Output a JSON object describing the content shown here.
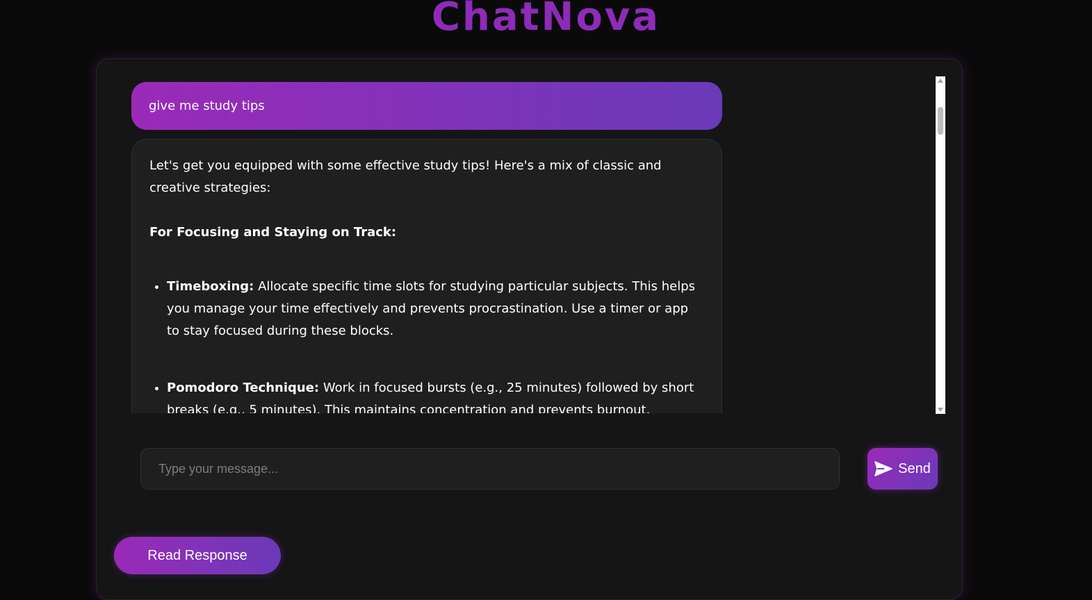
{
  "app": {
    "title": "ChatNova"
  },
  "chat": {
    "user_message": "give me study tips",
    "bot_intro": "Let's get you equipped with some effective study tips!  Here's a mix of classic and creative strategies:",
    "bot_heading": "For Focusing and Staying on Track:",
    "tips": [
      {
        "title": "Timeboxing:",
        "text": " Allocate specific time slots for studying particular subjects.  This helps you manage your time effectively and prevents procrastination.  Use a timer or app to stay focused during these blocks."
      },
      {
        "title": "Pomodoro Technique:",
        "text": " Work in focused bursts (e.g., 25 minutes) followed by short breaks (e.g., 5 minutes).  This maintains concentration and prevents burnout."
      }
    ]
  },
  "input": {
    "placeholder": "Type your message..."
  },
  "buttons": {
    "send_label": "Send",
    "read_label": "Read Response"
  },
  "icons": {
    "send": "send-arrow-icon"
  },
  "colors": {
    "accent_start": "#9a2ab8",
    "accent_end": "#6a3ab8",
    "title": "#8e2bb8",
    "background": "#0a0a0b",
    "panel": "#151516",
    "bubble": "#1f1f20"
  }
}
